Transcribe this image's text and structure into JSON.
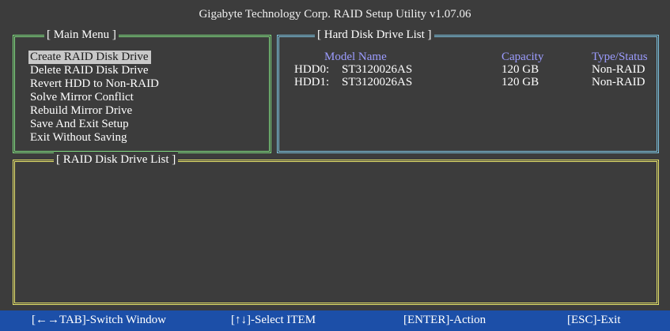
{
  "title": "Gigabyte Technology Corp.  RAID Setup Utility  v1.07.06",
  "main_menu": {
    "legend": "[ Main Menu ]",
    "items": [
      {
        "label": "Create RAID Disk Drive",
        "selected": true
      },
      {
        "label": "Delete RAID Disk Drive"
      },
      {
        "label": "Revert HDD to Non-RAID"
      },
      {
        "label": "Solve Mirror Conflict"
      },
      {
        "label": "Rebuild Mirror Drive"
      },
      {
        "label": "Save And Exit Setup"
      },
      {
        "label": "Exit Without Saving"
      }
    ]
  },
  "hdd_list": {
    "legend": "[ Hard Disk Drive List ]",
    "columns": {
      "model": "Model Name",
      "capacity": "Capacity",
      "type": "Type/Status"
    },
    "rows": [
      {
        "device": "HDD0:",
        "model": "ST3120026AS",
        "capacity": "120 GB",
        "type": "Non-RAID"
      },
      {
        "device": "HDD1:",
        "model": "ST3120026AS",
        "capacity": "120 GB",
        "type": "Non-RAID"
      }
    ]
  },
  "raid_list": {
    "legend": "[ RAID Disk Drive List ]"
  },
  "statusbar": {
    "switch_window": "[←→TAB]-Switch Window",
    "select_item": "[↑↓]-Select ITEM",
    "action": "[ENTER]-Action",
    "exit": "[ESC]-Exit"
  },
  "colors": {
    "background": "#3c3c3c",
    "main_menu_border": "#7fdc7f",
    "hdd_list_border": "#7dc3e0",
    "raid_list_border": "#e6e36a",
    "header_text": "#9c9cff",
    "statusbar": "#1c4fa8",
    "selection": "#c8c8c8"
  }
}
